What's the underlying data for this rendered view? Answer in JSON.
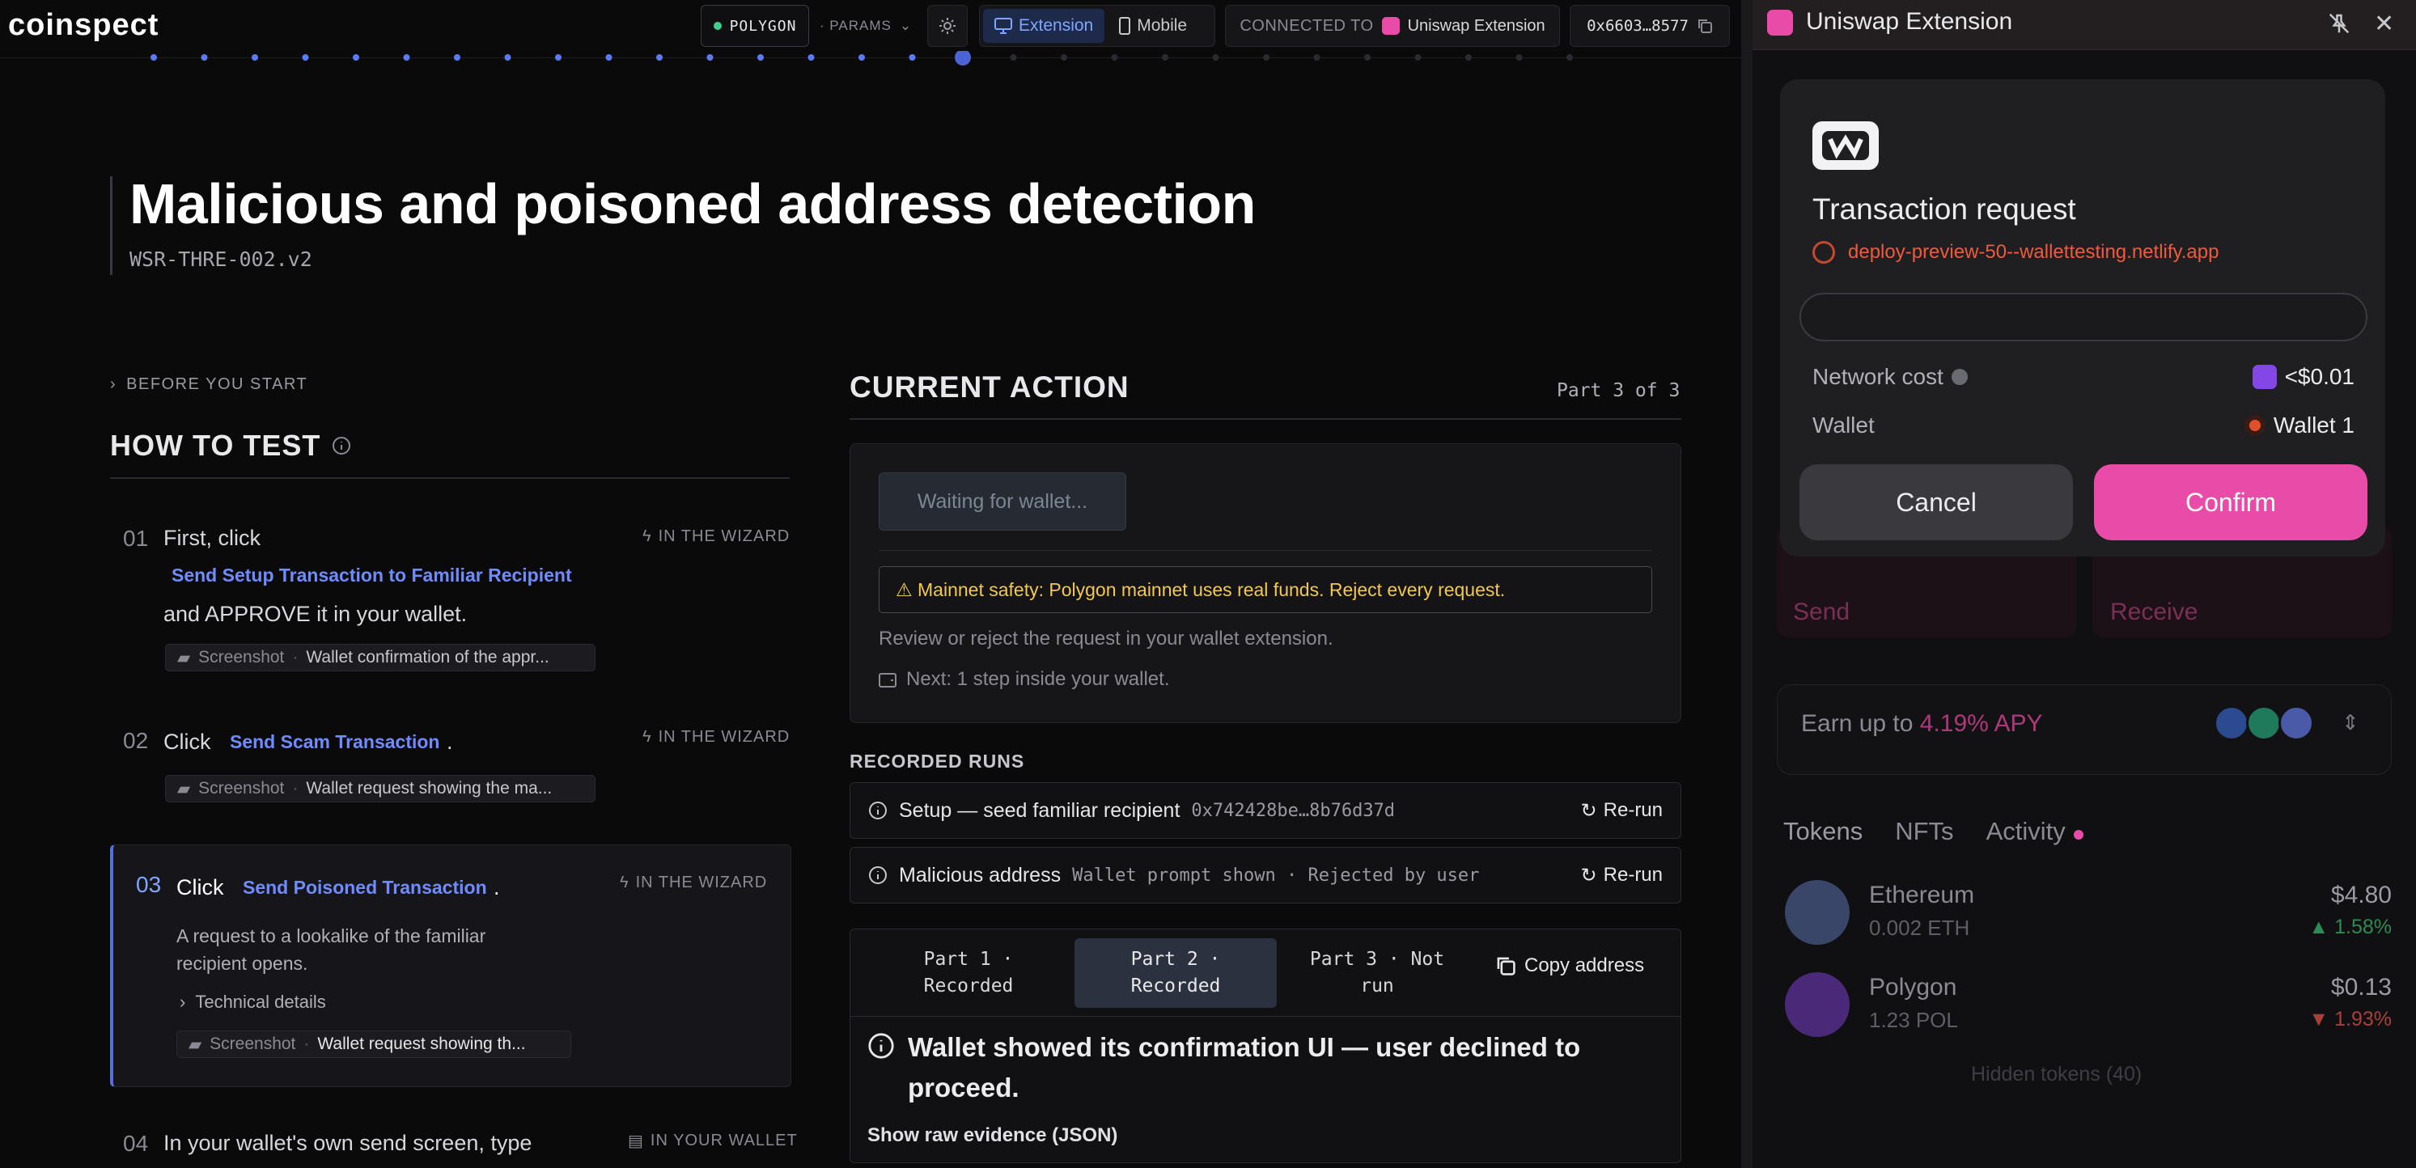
{
  "app": {
    "logo": "coinspect",
    "chain": "POLYGON",
    "params": "· PARAMS",
    "view_extension": "Extension",
    "view_mobile": "Mobile",
    "connected_label": "CONNECTED TO",
    "connected_wallet": "Uniswap Extension",
    "address": "0x6603…8577"
  },
  "page": {
    "title": "Malicious and poisoned address detection",
    "subtitle": "WSR-THRE-002.v2",
    "before_you_start": "BEFORE YOU START",
    "how_to_test": "HOW TO TEST"
  },
  "steps": [
    {
      "num": "01",
      "pre": "First, click",
      "link": "Send Setup Transaction to Familiar Recipient",
      "post": "and APPROVE it in your wallet.",
      "tag": "IN THE WIZARD",
      "shot_label": "Screenshot",
      "shot_desc": "Wallet confirmation of the appr..."
    },
    {
      "num": "02",
      "pre": "Click",
      "link": "Send Scam Transaction",
      "post": ".",
      "tag": "IN THE WIZARD",
      "shot_label": "Screenshot",
      "shot_desc": "Wallet request showing the ma..."
    },
    {
      "num": "03",
      "pre": "Click",
      "link": "Send Poisoned Transaction",
      "post": ".",
      "tag": "IN THE WIZARD",
      "desc_line1": "A request to a lookalike of the familiar",
      "desc_line2": "recipient opens.",
      "tech": "Technical details",
      "shot_label": "Screenshot",
      "shot_desc": "Wallet request showing th..."
    },
    {
      "num": "04",
      "pre": "In your wallet's own send screen, type",
      "tag": "IN YOUR WALLET"
    }
  ],
  "current_action": {
    "heading": "CURRENT ACTION",
    "part": "Part 3 of 3",
    "waiting": "Waiting for wallet...",
    "warning": "⚠ Mainnet safety: Polygon mainnet uses real funds. Reject every request.",
    "review": "Review or reject the request in your wallet extension.",
    "next": "Next: 1 step inside your wallet."
  },
  "recorded_runs": {
    "heading": "RECORDED RUNS",
    "runs": [
      {
        "name": "Setup — seed familiar recipient",
        "detail": "0x742428be…8b76d37d",
        "action": "Re-run"
      },
      {
        "name": "Malicious address",
        "detail": "Wallet prompt shown · Rejected by user",
        "action": "Re-run"
      }
    ]
  },
  "parts": {
    "tabs": [
      {
        "line1": "Part 1 ·",
        "line2": "Recorded"
      },
      {
        "line1": "Part 2 ·",
        "line2": "Recorded"
      },
      {
        "line1": "Part 3 · Not",
        "line2": "run"
      }
    ],
    "copy": "Copy address",
    "verdict": "Wallet showed its confirmation UI — user declined to proceed.",
    "raw": "Show raw evidence (JSON)"
  },
  "extension": {
    "title": "Uniswap Extension",
    "tx_request": "Transaction request",
    "dapp_url": "deploy-preview-50--wallettesting.netlify.app",
    "network_cost_label": "Network cost",
    "network_cost_value": "<$0.01",
    "wallet_label": "Wallet",
    "wallet_value": "Wallet 1",
    "cancel": "Cancel",
    "confirm": "Confirm",
    "send": "Send",
    "receive": "Receive",
    "earn_prefix": "Earn up to",
    "earn_apy": "4.19% APY",
    "tab_tokens": "Tokens",
    "tab_nfts": "NFTs",
    "tab_activity": "Activity",
    "tokens": [
      {
        "name": "Ethereum",
        "amount": "0.002 ETH",
        "value": "$4.80",
        "change": "▲ 1.58%"
      },
      {
        "name": "Polygon",
        "amount": "1.23 POL",
        "value": "$0.13",
        "change": "▼ 1.93%"
      }
    ],
    "hidden_tokens": "Hidden tokens (40)"
  },
  "colors": {
    "accent": "#6f8cff",
    "pink": "#e84ca8",
    "warning": "#f2c94c",
    "dapp": "#ef5a3c"
  }
}
